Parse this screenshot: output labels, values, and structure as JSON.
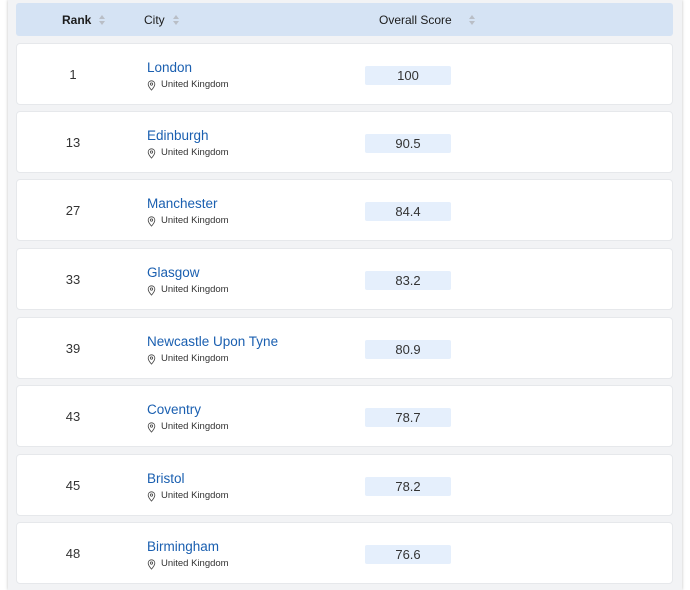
{
  "table": {
    "headers": {
      "rank": "Rank",
      "city": "City",
      "score": "Overall Score"
    },
    "rows": [
      {
        "rank": "1",
        "city": "London",
        "country": "United Kingdom",
        "score": "100"
      },
      {
        "rank": "13",
        "city": "Edinburgh",
        "country": "United Kingdom",
        "score": "90.5"
      },
      {
        "rank": "27",
        "city": "Manchester",
        "country": "United Kingdom",
        "score": "84.4"
      },
      {
        "rank": "33",
        "city": "Glasgow",
        "country": "United Kingdom",
        "score": "83.2"
      },
      {
        "rank": "39",
        "city": "Newcastle Upon Tyne",
        "country": "United Kingdom",
        "score": "80.9"
      },
      {
        "rank": "43",
        "city": "Coventry",
        "country": "United Kingdom",
        "score": "78.7"
      },
      {
        "rank": "45",
        "city": "Bristol",
        "country": "United Kingdom",
        "score": "78.2"
      },
      {
        "rank": "48",
        "city": "Birmingham",
        "country": "United Kingdom",
        "score": "76.6"
      }
    ]
  },
  "icons": {
    "sort": "sort-arrows-icon",
    "location": "location-pin-icon"
  },
  "colors": {
    "header_bg": "#d5e3f4",
    "city_link": "#1a5fb0",
    "score_bg": "#e5effc"
  }
}
